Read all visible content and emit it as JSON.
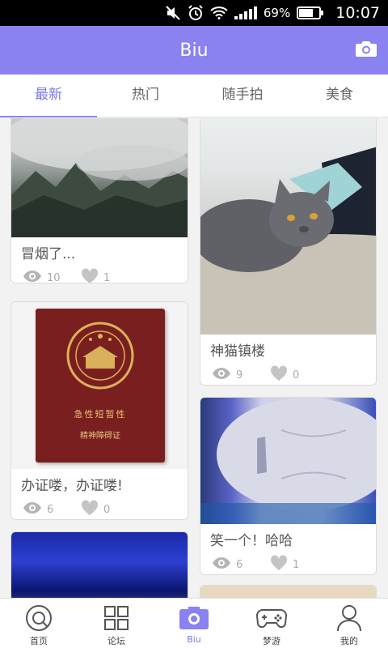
{
  "status": {
    "battery": "69%",
    "time": "10:07"
  },
  "app": {
    "title": "Biu"
  },
  "tabs": [
    {
      "label": "最新",
      "active": true
    },
    {
      "label": "热门",
      "active": false
    },
    {
      "label": "随手拍",
      "active": false
    },
    {
      "label": "美食",
      "active": false
    }
  ],
  "posts": [
    {
      "caption": "冒烟了...",
      "views": "10",
      "likes": "1"
    },
    {
      "caption": "神猫镇楼",
      "views": "9",
      "likes": "0"
    },
    {
      "caption": "办证喽，办证喽!",
      "views": "6",
      "likes": "0"
    },
    {
      "caption": "笑一个！哈哈",
      "views": "6",
      "likes": "1"
    }
  ],
  "certificate": {
    "line1": "急性短暂性",
    "line2": "精神障碍证"
  },
  "nav": [
    {
      "label": "首页",
      "icon": "home-icon",
      "active": false
    },
    {
      "label": "论坛",
      "icon": "grid-icon",
      "active": false
    },
    {
      "label": "Biu",
      "icon": "camera-icon",
      "active": true
    },
    {
      "label": "梦游",
      "icon": "gamepad-icon",
      "active": false
    },
    {
      "label": "我的",
      "icon": "user-icon",
      "active": false
    }
  ],
  "colors": {
    "accent": "#8a82f0",
    "active_text": "#7d77e8"
  }
}
